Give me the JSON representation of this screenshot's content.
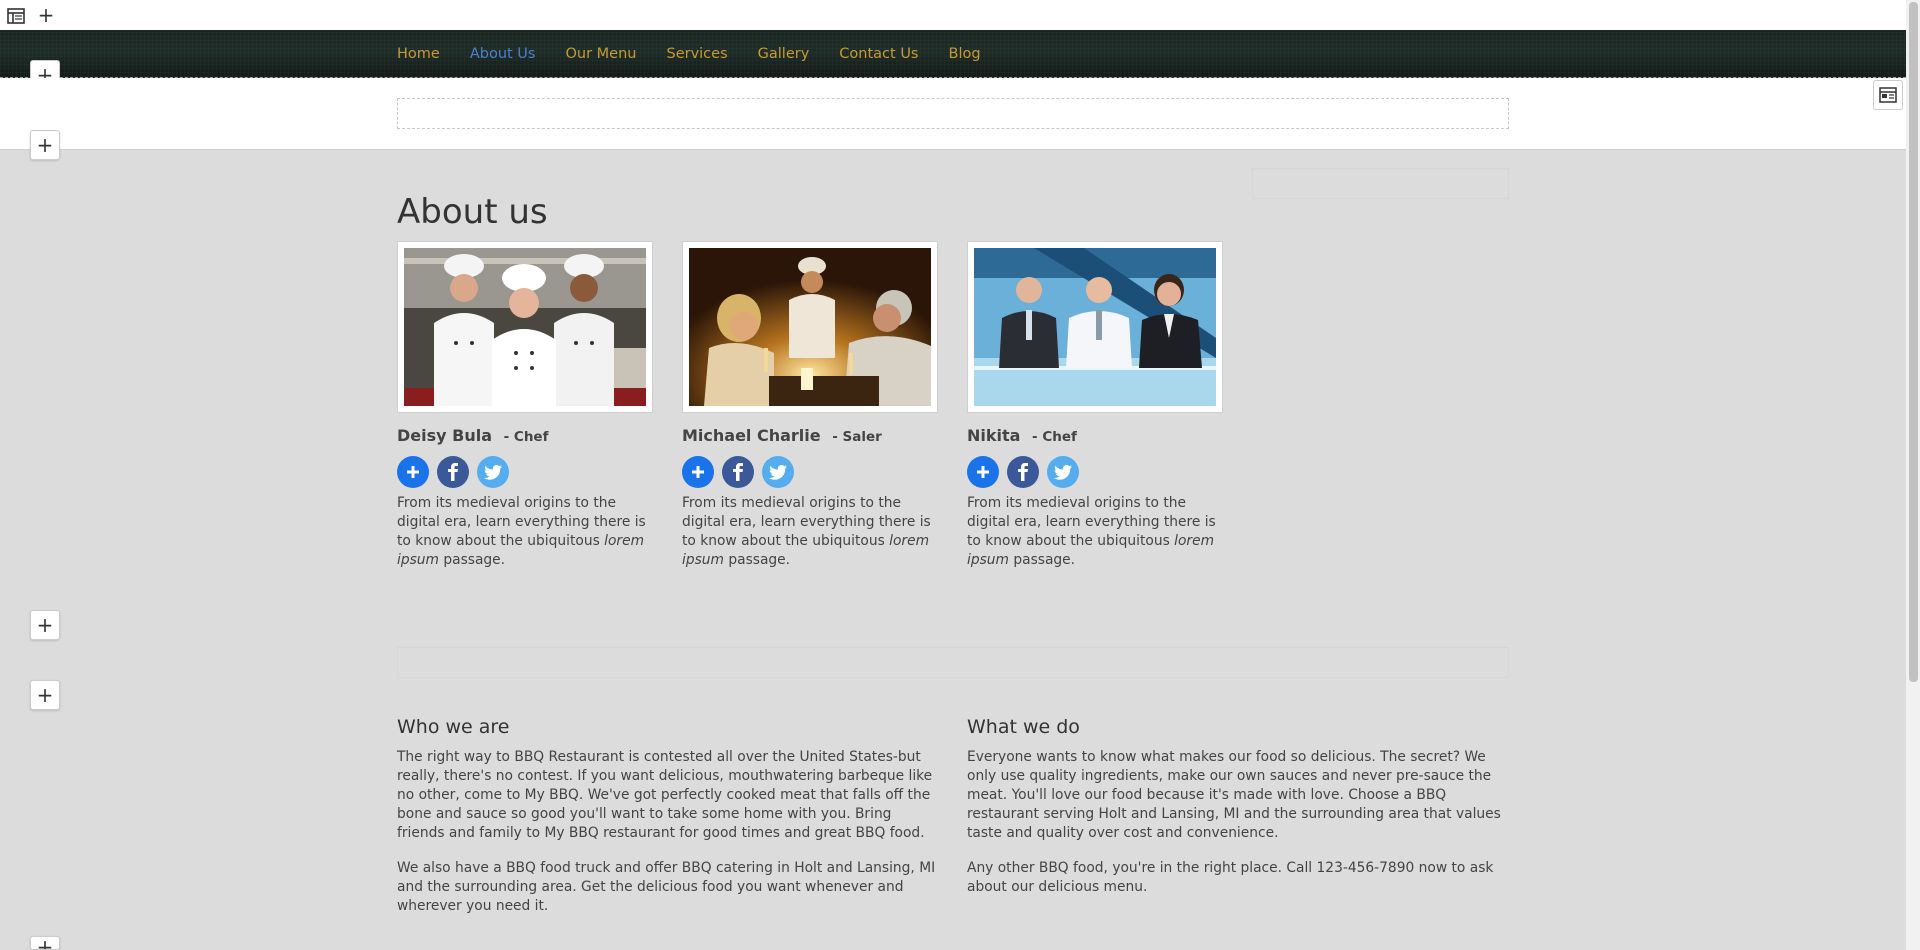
{
  "nav": {
    "items": [
      {
        "label": "Home",
        "active": false
      },
      {
        "label": "About Us",
        "active": true
      },
      {
        "label": "Our Menu",
        "active": false
      },
      {
        "label": "Services",
        "active": false
      },
      {
        "label": "Gallery",
        "active": false
      },
      {
        "label": "Contact Us",
        "active": false
      },
      {
        "label": "Blog",
        "active": false
      }
    ]
  },
  "colors": {
    "nav_link": "#c79a33",
    "nav_active": "#4a7fd0",
    "background": "#dcdcdc",
    "navbar": "#1a2621"
  },
  "page": {
    "title": "About us"
  },
  "team": [
    {
      "name": "Deisy Bula",
      "role": "Chef",
      "photo": "three-chefs-photo",
      "desc_before": "From its medieval origins to the digital era, learn everything there is to know about the ubiquitous ",
      "desc_em": "lorem ipsum",
      "desc_after": " passage."
    },
    {
      "name": "Michael Charlie",
      "role": "Saler",
      "photo": "candlelit-dinner-photo",
      "desc_before": "From its medieval origins to the digital era, learn everything there is to know about the ubiquitous ",
      "desc_em": "lorem ipsum",
      "desc_after": " passage."
    },
    {
      "name": "Nikita",
      "role": "Chef",
      "photo": "business-meeting-photo",
      "desc_before": "From its medieval origins to the digital era, learn everything there is to know about the ubiquitous ",
      "desc_em": "lorem ipsum",
      "desc_after": " passage."
    }
  ],
  "who": {
    "heading": "Who we are",
    "p1": "The right way to BBQ Restaurant is contested all over the United States-but really, there's no contest. If you want delicious, mouthwatering barbeque like no other, come to My BBQ. We've got perfectly cooked meat that falls off the bone and sauce so good you'll want to take some home with you. Bring friends and family to My BBQ restaurant for good times and great BBQ food.",
    "p2": "We also have a BBQ food truck and offer BBQ catering in Holt and Lansing, MI and the surrounding area. Get the delicious food you want whenever and wherever you need it."
  },
  "what": {
    "heading": "What we do",
    "p1": "Everyone wants to know what makes our food so delicious. The secret? We only use quality ingredients, make our own sauces and never pre-sauce the meat. You'll love our food because it's made with love. Choose a BBQ restaurant serving Holt and Lansing, MI and the surrounding area that values taste and quality over cost and convenience.",
    "p2": "Any other BBQ food, you're in the right place. Call 123-456-7890 now to ask about our delicious menu."
  },
  "editor": {
    "add_label": "+",
    "icons": [
      "layout-icon",
      "add-icon",
      "panel-icon"
    ]
  }
}
